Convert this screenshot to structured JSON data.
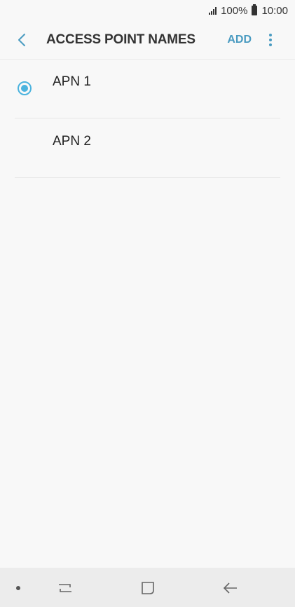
{
  "status_bar": {
    "battery": "100%",
    "time": "10:00"
  },
  "header": {
    "title": "ACCESS POINT NAMES",
    "add_label": "ADD"
  },
  "apn_list": {
    "items": [
      {
        "label": "APN 1",
        "selected": true
      },
      {
        "label": "APN 2",
        "selected": false
      }
    ]
  },
  "colors": {
    "accent": "#4a9bc1",
    "radio": "#4bb3de",
    "background": "#f8f8f8",
    "nav_bar": "#ececec"
  },
  "icons": {
    "back": "chevron-left-icon",
    "more": "more-vertical-icon",
    "signal": "signal-icon",
    "battery": "battery-icon",
    "recent_apps": "recent-apps-icon",
    "home": "home-icon",
    "back_nav": "back-arrow-icon"
  }
}
